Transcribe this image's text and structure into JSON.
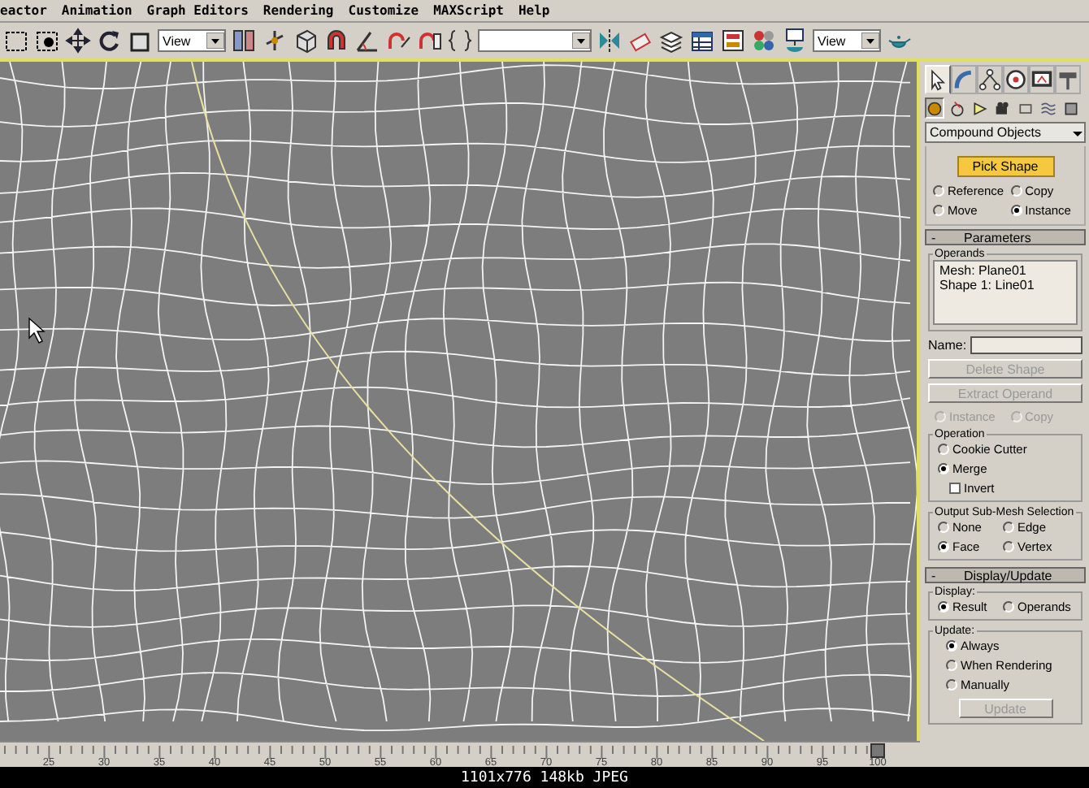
{
  "menu": [
    "eactor",
    "Animation",
    "Graph Editors",
    "Rendering",
    "Customize",
    "MAXScript",
    "Help"
  ],
  "toolbar": [
    {
      "kind": "icon"
    },
    {
      "kind": "icon"
    },
    {
      "kind": "icon"
    },
    {
      "kind": "icon"
    },
    {
      "kind": "icon"
    },
    {
      "kind": "dropdown",
      "value": "View"
    },
    {
      "kind": "icon"
    },
    {
      "kind": "icon"
    },
    {
      "kind": "icon"
    },
    {
      "kind": "icon"
    },
    {
      "kind": "icon"
    },
    {
      "kind": "icon"
    },
    {
      "kind": "icon"
    },
    {
      "kind": "icon"
    },
    {
      "kind": "dropdown"
    },
    {
      "kind": "icon"
    },
    {
      "kind": "icon"
    },
    {
      "kind": "icon"
    },
    {
      "kind": "icon"
    },
    {
      "kind": "icon"
    },
    {
      "kind": "icon"
    },
    {
      "kind": "icon"
    },
    {
      "kind": "dropdown",
      "value": "View"
    },
    {
      "kind": "icon"
    }
  ],
  "ruler": {
    "labels": [
      "25",
      "30",
      "35",
      "40",
      "45",
      "50",
      "55",
      "60",
      "65",
      "70",
      "75",
      "80",
      "85",
      "90",
      "95",
      "100"
    ],
    "time_slider": {
      "level": 1.0
    }
  },
  "panel": {
    "command_tabs": [
      {
        "selected": true
      },
      {
        "selected": false
      },
      {
        "selected": false
      },
      {
        "selected": false
      },
      {
        "selected": false
      },
      {
        "selected": false
      }
    ],
    "create_categories": [
      {
        "selected": true
      },
      {
        "selected": false
      },
      {
        "selected": false
      },
      {
        "selected": false
      },
      {
        "selected": false
      },
      {
        "selected": false
      },
      {
        "selected": false
      }
    ],
    "object_type": "Compound Objects",
    "pick_button": "Pick Shape",
    "pick_mode": [
      {
        "label": "Reference",
        "selected": false
      },
      {
        "label": "Copy",
        "selected": false
      },
      {
        "label": "Move",
        "selected": false
      },
      {
        "label": "Instance",
        "selected": true
      }
    ],
    "parameters": {
      "title": "Parameters",
      "minus": "-",
      "operands": {
        "title": "Operands",
        "items": [
          "Mesh: Plane01",
          "Shape 1: Line01"
        ]
      },
      "name_label": "Name:",
      "buttons": [
        {
          "label": "Delete Shape",
          "disabled": true
        },
        {
          "label": "Extract Operand",
          "disabled": true
        }
      ],
      "extract_mode": [
        {
          "label": "Instance",
          "selected": false,
          "disabled": true
        },
        {
          "label": "Copy",
          "selected": false,
          "disabled": true
        }
      ],
      "operation": {
        "title": "Operation",
        "options": [
          {
            "label": "Cookie Cutter",
            "selected": false
          },
          {
            "label": "Merge",
            "selected": true
          }
        ],
        "invert": {
          "label": "Invert",
          "checked": false
        }
      },
      "output": {
        "title": "Output Sub-Mesh Selection",
        "options": [
          {
            "label": "None",
            "selected": false
          },
          {
            "label": "Edge",
            "selected": false
          },
          {
            "label": "Face",
            "selected": true
          },
          {
            "label": "Vertex",
            "selected": false
          }
        ]
      }
    },
    "display_update": {
      "title": "Display/Update",
      "minus": "-",
      "display": {
        "title": "Display:",
        "options": [
          {
            "label": "Result",
            "selected": true
          },
          {
            "label": "Operands",
            "selected": false
          }
        ]
      },
      "update": {
        "title": "Update:",
        "options": [
          {
            "label": "Always",
            "selected": true
          },
          {
            "label": "When Rendering",
            "selected": false
          },
          {
            "label": "Manually",
            "selected": false
          }
        ],
        "button": {
          "label": "Update",
          "disabled": true
        }
      }
    }
  },
  "caption": "1101x776 148kb JPEG"
}
